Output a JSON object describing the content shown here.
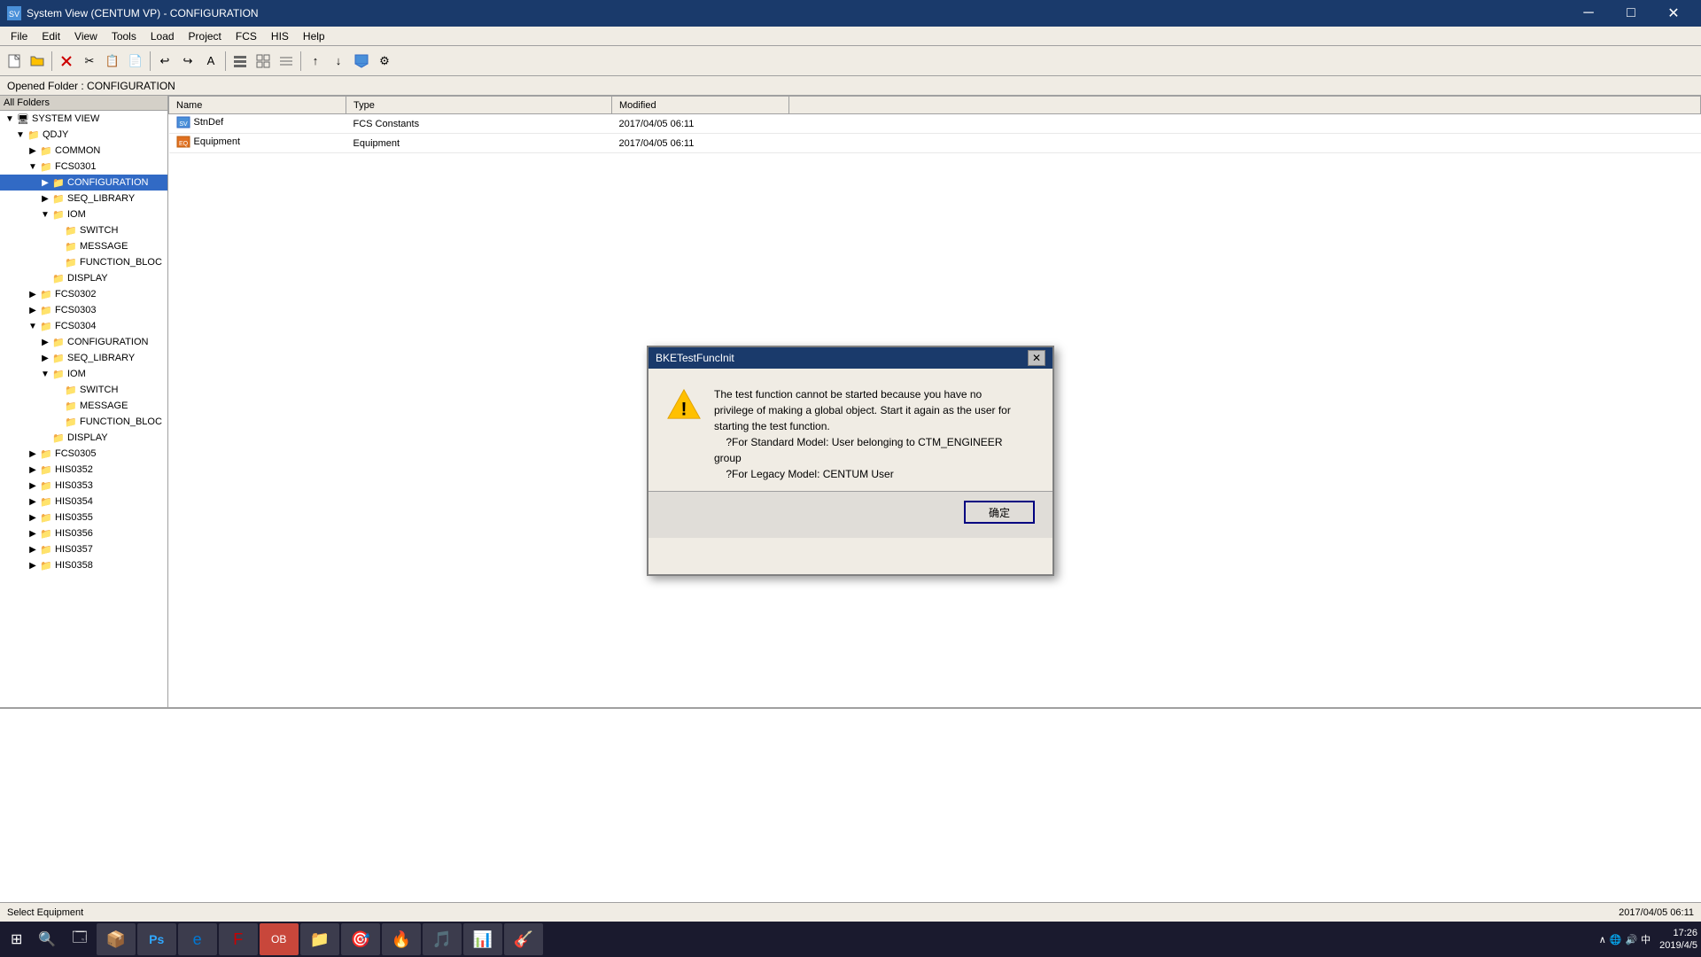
{
  "app": {
    "title": "System View (CENTUM VP) - CONFIGURATION",
    "icon": "SV"
  },
  "titlebar": {
    "minimize": "─",
    "maximize": "□",
    "close": "✕"
  },
  "menubar": {
    "items": [
      "File",
      "Edit",
      "View",
      "Tools",
      "Load",
      "Project",
      "FCS",
      "HIS",
      "Help"
    ]
  },
  "toolbar": {
    "buttons": [
      "📁",
      "💾",
      "✕",
      "✂",
      "📋",
      "📄",
      "↩",
      "↪",
      "A",
      "≡",
      "⊞",
      "⊟",
      "→",
      "↓",
      "⊕",
      "⊗",
      "⚙"
    ]
  },
  "folder_bar": {
    "label": "Opened Folder : CONFIGURATION"
  },
  "tree": {
    "header": "All Folders",
    "items": [
      {
        "id": "system-view",
        "label": "SYSTEM VIEW",
        "indent": 0,
        "expanded": true,
        "type": "root"
      },
      {
        "id": "qdjy",
        "label": "QDJY",
        "indent": 1,
        "expanded": true,
        "type": "folder"
      },
      {
        "id": "common",
        "label": "COMMON",
        "indent": 2,
        "expanded": false,
        "type": "folder"
      },
      {
        "id": "fcs0301",
        "label": "FCS0301",
        "indent": 2,
        "expanded": true,
        "type": "folder"
      },
      {
        "id": "configuration1",
        "label": "CONFIGURATION",
        "indent": 3,
        "expanded": false,
        "type": "folder",
        "selected": true
      },
      {
        "id": "seq-library",
        "label": "SEQ_LIBRARY",
        "indent": 3,
        "expanded": false,
        "type": "folder"
      },
      {
        "id": "iom",
        "label": "IOM",
        "indent": 3,
        "expanded": true,
        "type": "folder"
      },
      {
        "id": "switch",
        "label": "SWITCH",
        "indent": 4,
        "expanded": false,
        "type": "folder"
      },
      {
        "id": "message",
        "label": "MESSAGE",
        "indent": 4,
        "expanded": false,
        "type": "folder"
      },
      {
        "id": "function-block",
        "label": "FUNCTION_BLOC",
        "indent": 4,
        "expanded": false,
        "type": "folder"
      },
      {
        "id": "display",
        "label": "DISPLAY",
        "indent": 3,
        "expanded": false,
        "type": "folder"
      },
      {
        "id": "fcs0302",
        "label": "FCS0302",
        "indent": 2,
        "expanded": false,
        "type": "folder"
      },
      {
        "id": "fcs0303",
        "label": "FCS0303",
        "indent": 2,
        "expanded": false,
        "type": "folder"
      },
      {
        "id": "fcs0304",
        "label": "FCS0304",
        "indent": 2,
        "expanded": true,
        "type": "folder"
      },
      {
        "id": "configuration2",
        "label": "CONFIGURATION",
        "indent": 3,
        "expanded": false,
        "type": "folder"
      },
      {
        "id": "seq-library2",
        "label": "SEQ_LIBRARY",
        "indent": 3,
        "expanded": false,
        "type": "folder"
      },
      {
        "id": "iom2",
        "label": "IOM",
        "indent": 3,
        "expanded": true,
        "type": "folder"
      },
      {
        "id": "switch2",
        "label": "SWITCH",
        "indent": 4,
        "expanded": false,
        "type": "folder"
      },
      {
        "id": "message2",
        "label": "MESSAGE",
        "indent": 4,
        "expanded": false,
        "type": "folder"
      },
      {
        "id": "function-block2",
        "label": "FUNCTION_BLOC",
        "indent": 4,
        "expanded": false,
        "type": "folder"
      },
      {
        "id": "display2",
        "label": "DISPLAY",
        "indent": 3,
        "expanded": false,
        "type": "folder"
      },
      {
        "id": "fcs0305",
        "label": "FCS0305",
        "indent": 2,
        "expanded": false,
        "type": "folder"
      },
      {
        "id": "his0352",
        "label": "HIS0352",
        "indent": 2,
        "expanded": false,
        "type": "folder"
      },
      {
        "id": "his0353",
        "label": "HIS0353",
        "indent": 2,
        "expanded": false,
        "type": "folder"
      },
      {
        "id": "his0354",
        "label": "HIS0354",
        "indent": 2,
        "expanded": false,
        "type": "folder"
      },
      {
        "id": "his0355",
        "label": "HIS0355",
        "indent": 2,
        "expanded": false,
        "type": "folder"
      },
      {
        "id": "his0356",
        "label": "HIS0356",
        "indent": 2,
        "expanded": false,
        "type": "folder"
      },
      {
        "id": "his0357",
        "label": "HIS0357",
        "indent": 2,
        "expanded": false,
        "type": "folder"
      },
      {
        "id": "his0358",
        "label": "HIS0358",
        "indent": 2,
        "expanded": false,
        "type": "folder"
      }
    ]
  },
  "file_table": {
    "columns": [
      "Name",
      "Type",
      "Modified"
    ],
    "rows": [
      {
        "name": "StnDef",
        "type": "FCS Constants",
        "modified": "2017/04/05 06:11",
        "icon": "SV"
      },
      {
        "name": "Equipment",
        "type": "Equipment",
        "modified": "2017/04/05 06:11",
        "icon": "EQ"
      }
    ]
  },
  "modal": {
    "title": "BKETestFuncInit",
    "message_line1": "The test function cannot be started because you have no",
    "message_line2": "privilege of making a global object. Start it again as the user for",
    "message_line3": "starting the test function.",
    "message_line4": "?For Standard Model: User belonging to CTM_ENGINEER",
    "message_line5": "group",
    "message_line6": "?For Legacy Model: CENTUM User",
    "ok_button": "确定"
  },
  "status_bar": {
    "left": "Select Equipment",
    "right_date": "2017/04/05 06:11"
  },
  "taskbar": {
    "time": "17:26",
    "date": "2019/4/5",
    "apps": [
      "⊞",
      "🔍",
      "🗔",
      "📦",
      "🎨",
      "Ps",
      "e",
      "f",
      "OB",
      "📁",
      "🎯",
      "🔥",
      "🎵",
      "📊",
      "🎸"
    ],
    "tray_icons": [
      "∧",
      "🔊",
      "中"
    ]
  }
}
